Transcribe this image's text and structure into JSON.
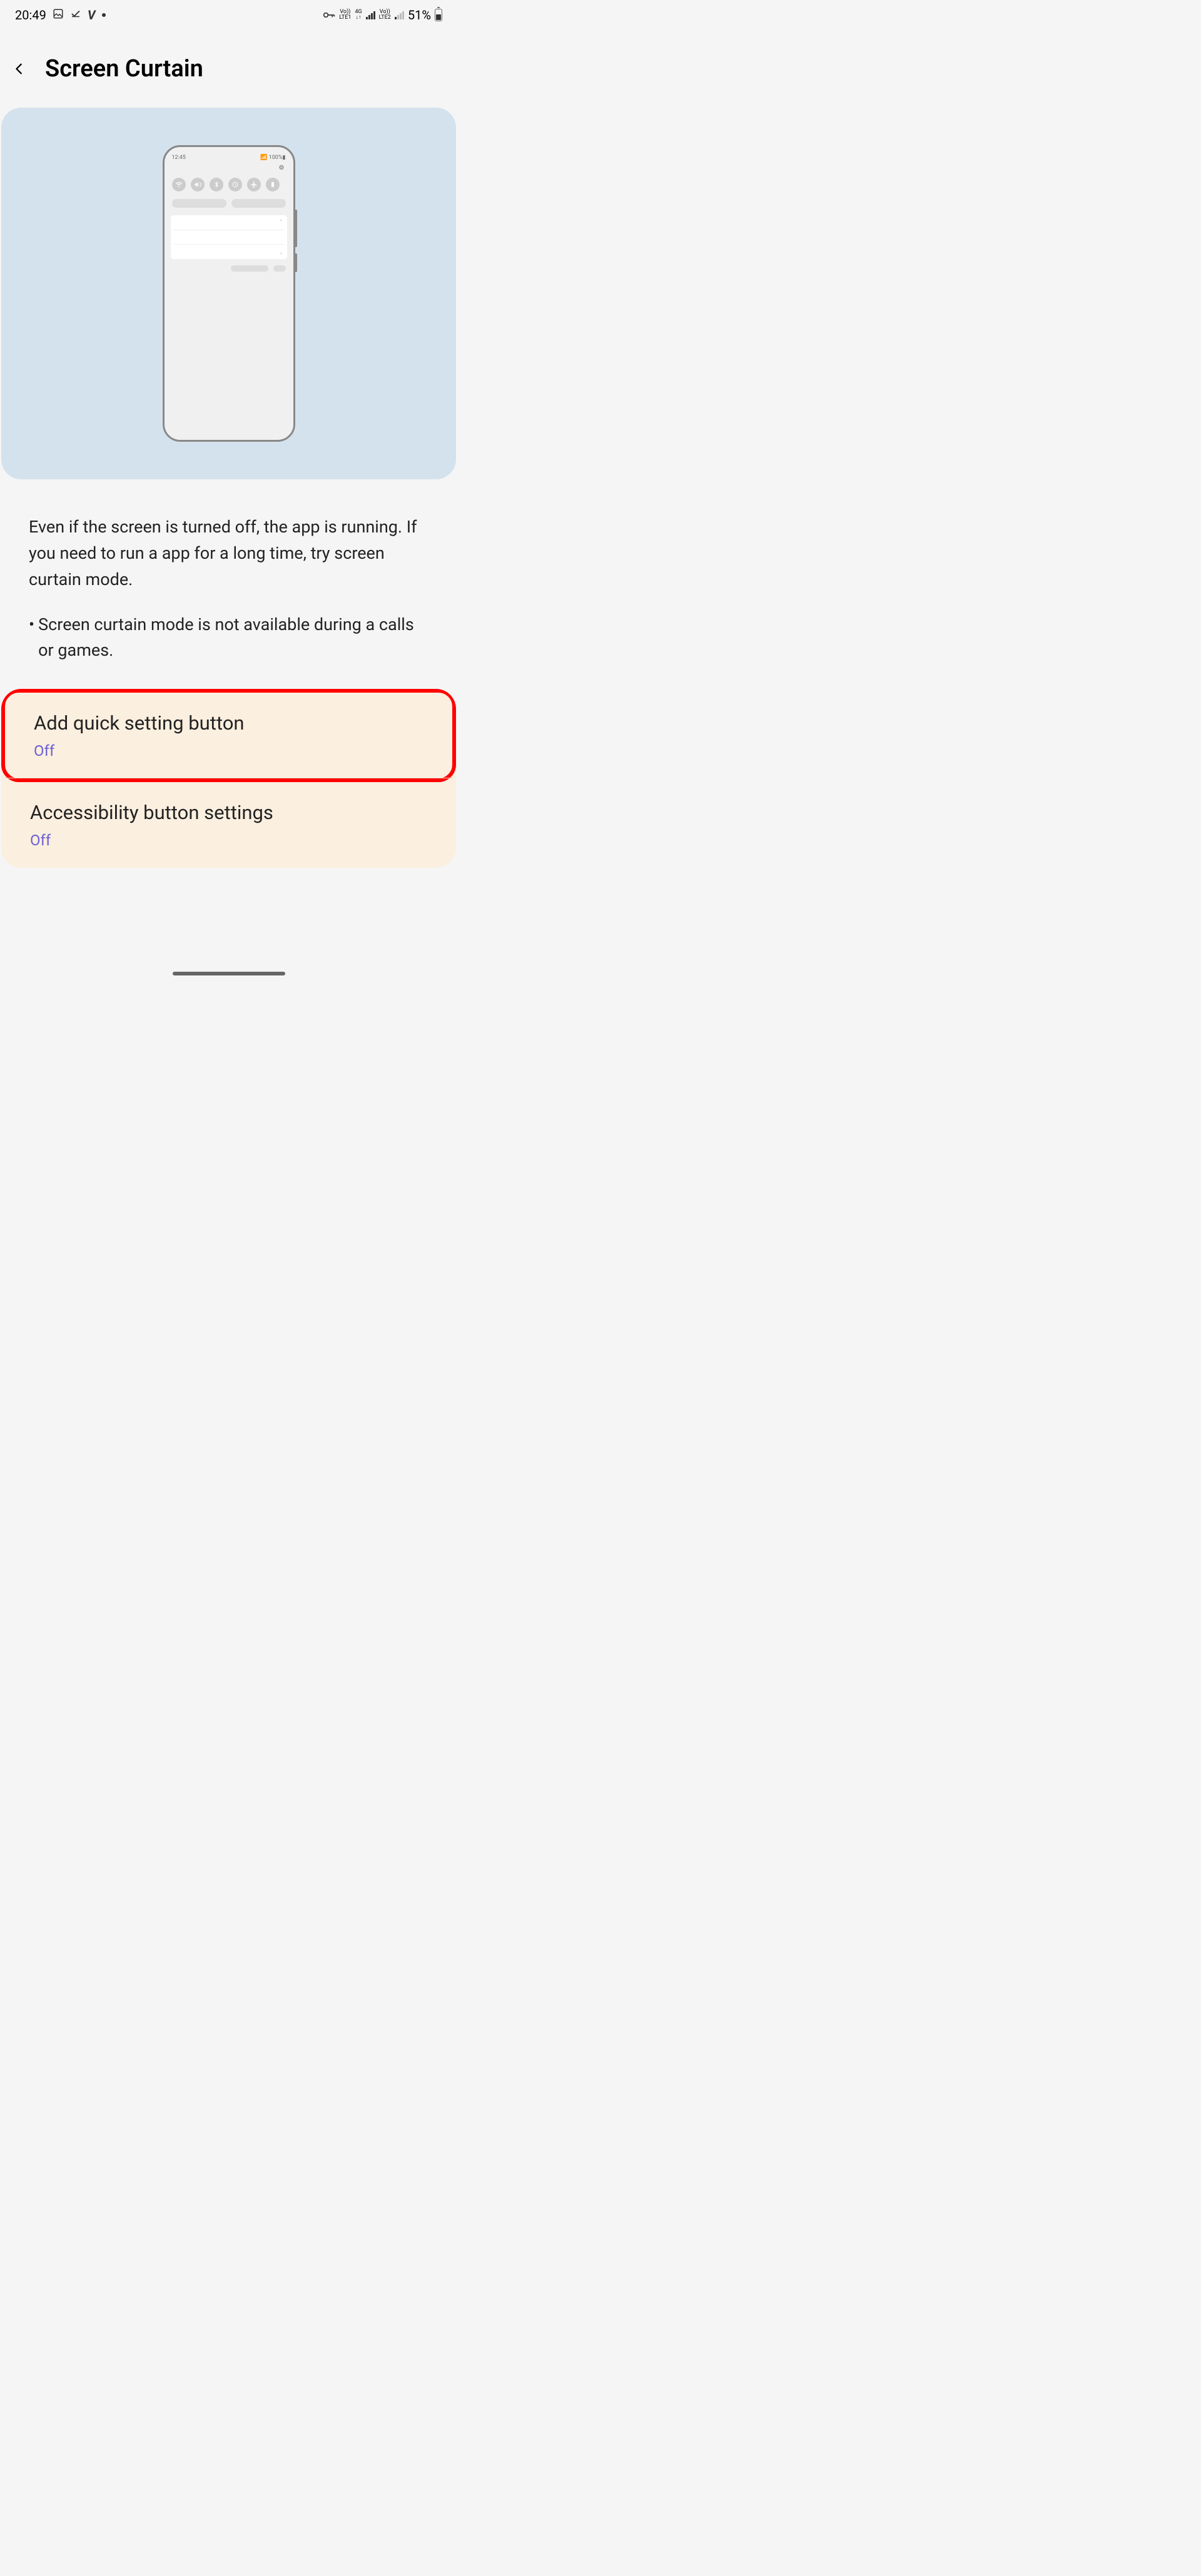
{
  "statusBar": {
    "time": "20:49",
    "batteryPercent": "51%"
  },
  "header": {
    "title": "Screen Curtain"
  },
  "mockup": {
    "time": "12:45",
    "battery": "100%"
  },
  "description": "Even if the screen is turned off, the app is running. If you need to run a app for a long time, try screen curtain mode.",
  "note": "Screen curtain mode is not available during a calls or games.",
  "settings": [
    {
      "label": "Add quick setting button",
      "value": "Off"
    },
    {
      "label": "Accessibility button settings",
      "value": "Off"
    }
  ]
}
